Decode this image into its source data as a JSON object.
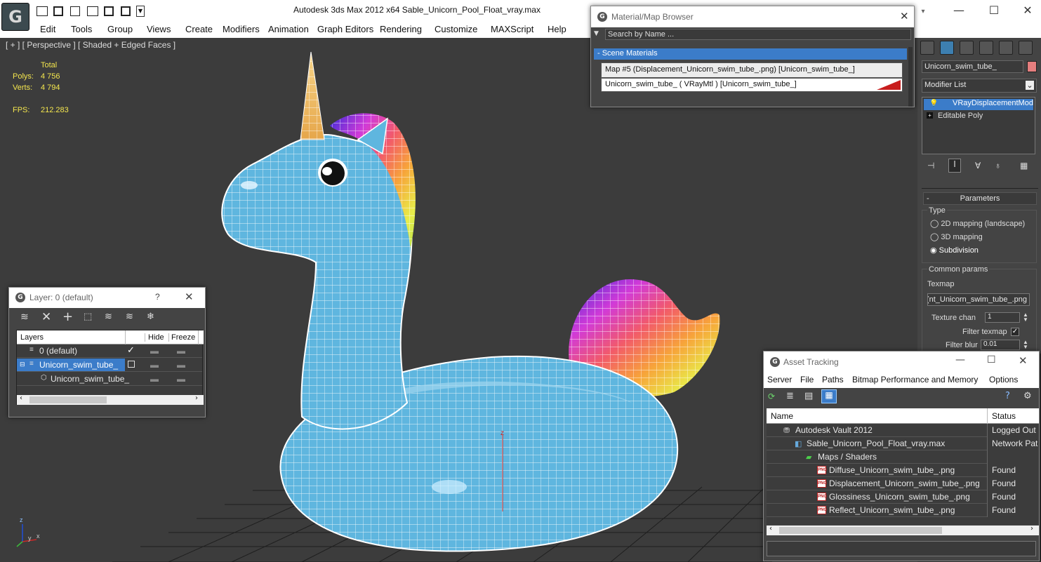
{
  "window": {
    "title": "Autodesk 3ds Max  2012 x64      Sable_Unicorn_Pool_Float_vray.max",
    "app_logo_glyph": "G"
  },
  "menu": [
    "Edit",
    "Tools",
    "Group",
    "Views",
    "Create",
    "Modifiers",
    "Animation",
    "Graph Editors",
    "Rendering",
    "Customize",
    "MAXScript",
    "Help"
  ],
  "viewport": {
    "label": "[ + ] [ Perspective ] [ Shaded + Edged Faces ]",
    "stats": {
      "total_label": "Total",
      "polys_label": "Polys:",
      "polys_value": "4 756",
      "verts_label": "Verts:",
      "verts_value": "4 794",
      "fps_label": "FPS:",
      "fps_value": "212.283"
    },
    "gizmo_z": "z",
    "axis_labels": {
      "y": "y",
      "x": "x",
      "z": "z"
    }
  },
  "material_browser": {
    "title": "Material/Map Browser",
    "search_placeholder": "Search by Name ...",
    "group_label": "- Scene Materials",
    "items": [
      "Map #5 (Displacement_Unicorn_swim_tube_.png) [Unicorn_swim_tube_]",
      "Unicorn_swim_tube_  ( VRayMtl ) [Unicorn_swim_tube_]"
    ],
    "swatch_color": "#c81e1e"
  },
  "command_panel": {
    "object_name": "Unicorn_swim_tube_",
    "object_color": "#e57e7e",
    "modifier_list": "Modifier List",
    "stack": [
      "VRayDisplacementMod",
      "Editable Poly"
    ],
    "rollout_title": "Parameters",
    "type_label": "Type",
    "type_options": [
      "2D mapping (landscape)",
      "3D mapping",
      "Subdivision"
    ],
    "type_selected": "Subdivision",
    "common_label": "Common params",
    "texmap_label": "Texmap",
    "texmap_value": "nt_Unicorn_swim_tube_.png)",
    "texture_chan_label": "Texture chan",
    "texture_chan_value": "1",
    "filter_texmap_label": "Filter texmap",
    "filter_blur_label": "Filter blur",
    "filter_blur_value": "0.01"
  },
  "layer_window": {
    "title": "Layer: 0 (default)",
    "help": "?",
    "columns": [
      "Layers",
      "Hide",
      "Freeze"
    ],
    "rows": [
      {
        "label": "0 (default)",
        "selected": false,
        "indent": 1
      },
      {
        "label": "Unicorn_swim_tube_",
        "selected": true,
        "indent": 1
      },
      {
        "label": "Unicorn_swim_tube_",
        "selected": false,
        "indent": 2
      }
    ]
  },
  "asset_tracking": {
    "title": "Asset Tracking",
    "menu": [
      "Server",
      "File",
      "Paths",
      "Bitmap Performance and Memory",
      "Options"
    ],
    "columns": [
      "Name",
      "Status"
    ],
    "rows": [
      {
        "name": "Autodesk Vault 2012",
        "status": "Logged Out",
        "indent": 1,
        "icon": "vault"
      },
      {
        "name": "Sable_Unicorn_Pool_Float_vray.max",
        "status": "Network Pat",
        "indent": 2,
        "icon": "max"
      },
      {
        "name": "Maps / Shaders",
        "status": "",
        "indent": 3,
        "icon": "maps"
      },
      {
        "name": "Diffuse_Unicorn_swim_tube_.png",
        "status": "Found",
        "indent": 4,
        "icon": "png"
      },
      {
        "name": "Displacement_Unicorn_swim_tube_.png",
        "status": "Found",
        "indent": 4,
        "icon": "png"
      },
      {
        "name": "Glossiness_Unicorn_swim_tube_.png",
        "status": "Found",
        "indent": 4,
        "icon": "png"
      },
      {
        "name": "Reflect_Unicorn_swim_tube_.png",
        "status": "Found",
        "indent": 4,
        "icon": "png"
      }
    ],
    "png_badge": "PNG"
  }
}
